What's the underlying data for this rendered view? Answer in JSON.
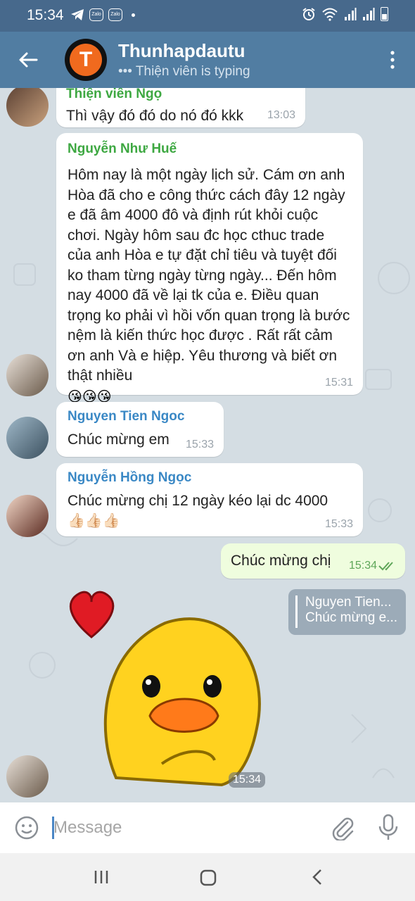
{
  "status_bar": {
    "time": "15:34",
    "icons": [
      "telegram-icon",
      "zalo-icon",
      "zalo-icon",
      "notification-dot",
      "alarm-icon",
      "wifi-icon",
      "signal-icon",
      "signal-icon",
      "battery-icon"
    ],
    "zalo_label": "Zalo"
  },
  "header": {
    "title": "Thunhapdautu",
    "status": "Thiện viên is typing",
    "avatar_letter": "T"
  },
  "messages": [
    {
      "sender": "Thiện viên Ngọ",
      "text": "Thì vậy đó đó do nó đó kkk",
      "time": "13:03"
    },
    {
      "sender": "Nguyễn Như Huế",
      "text": "Hôm nay là một ngày lịch sử. Cám ơn anh Hòa đã cho e công thức cách đây 12 ngày e đã âm 4000 đô và định rút khỏi cuộc chơi. Ngày hôm sau đc học cthuc trade của anh Hòa e tự đặt chỉ tiêu và tuyệt đối ko tham từng ngày từng ngày... Đến hôm nay 4000 đã về lại tk của e. Điều quan trọng ko phải vì hồi vốn quan trọng là bước nệm là kiến thức học được . Rất rất cảm ơn anh Và e hiệp. Yêu thương và biết ơn thật nhiều",
      "emoji": "😘😘😘",
      "time": "15:31"
    },
    {
      "sender": "Nguyen Tien Ngoc",
      "text": "Chúc mừng em",
      "time": "15:33"
    },
    {
      "sender": "Nguyễn Hồng Ngọc",
      "text": "Chúc mừng chị 12 ngày kéo lại dc 4000",
      "emoji": "👍🏻👍🏻👍🏻",
      "time": "15:33"
    },
    {
      "sender": "",
      "text": "Chúc mừng chị",
      "time": "15:34",
      "outgoing": true
    }
  ],
  "reply_preview": {
    "name": "Nguyen Tien...",
    "text": "Chúc mừng e..."
  },
  "sticker": {
    "time": "15:34"
  },
  "input": {
    "placeholder": "Message",
    "value": ""
  },
  "colors": {
    "header": "#517da2",
    "status_bar": "#47698c",
    "chat_bg": "#d4dde3",
    "outgoing_bubble": "#effdde",
    "sender_green": "#3ea842",
    "sender_blue": "#3a88c5"
  }
}
